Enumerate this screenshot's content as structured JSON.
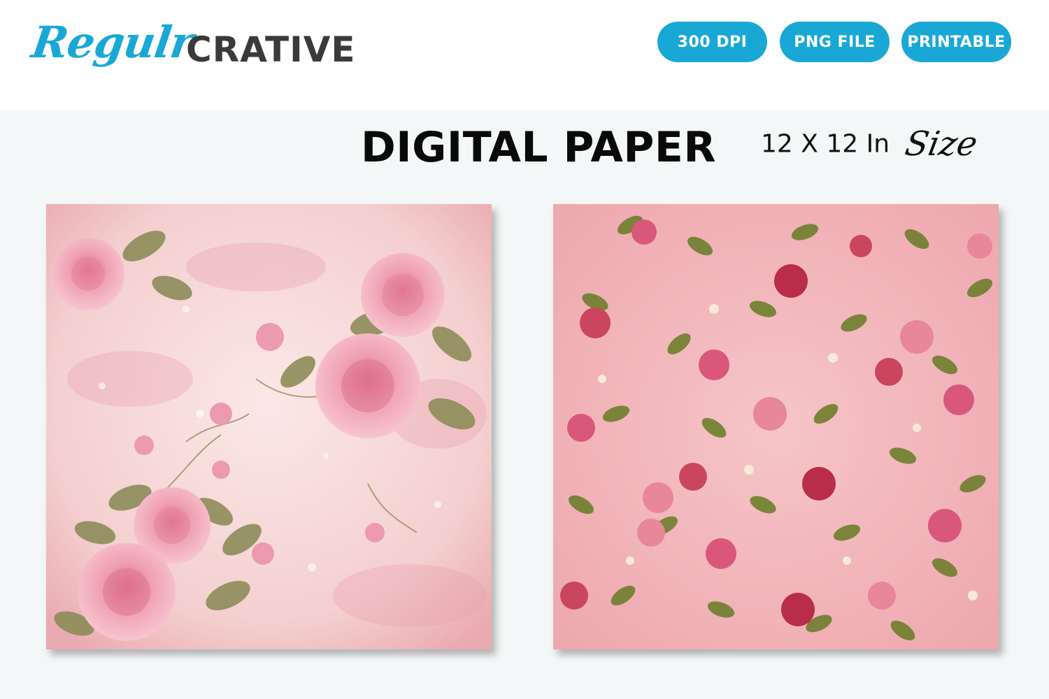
{
  "brand": {
    "script_part": "Regulr",
    "block_part": "CRATIVE",
    "script_color": "#19a8d6",
    "block_color": "#3a3a3a"
  },
  "badges": [
    {
      "label": "300 DPI"
    },
    {
      "label": "PNG FILE"
    },
    {
      "label": "PRINTABLE"
    }
  ],
  "badge_color": "#19a8d6",
  "heading": {
    "title": "DIGITAL PAPER",
    "size_text": "12 X 12 In",
    "size_script": "Size"
  },
  "papers": [
    {
      "pattern": "large pink roses with olive leaves on distressed light pink background"
    },
    {
      "pattern": "small red and pink roses with green leaves on pink background"
    }
  ]
}
